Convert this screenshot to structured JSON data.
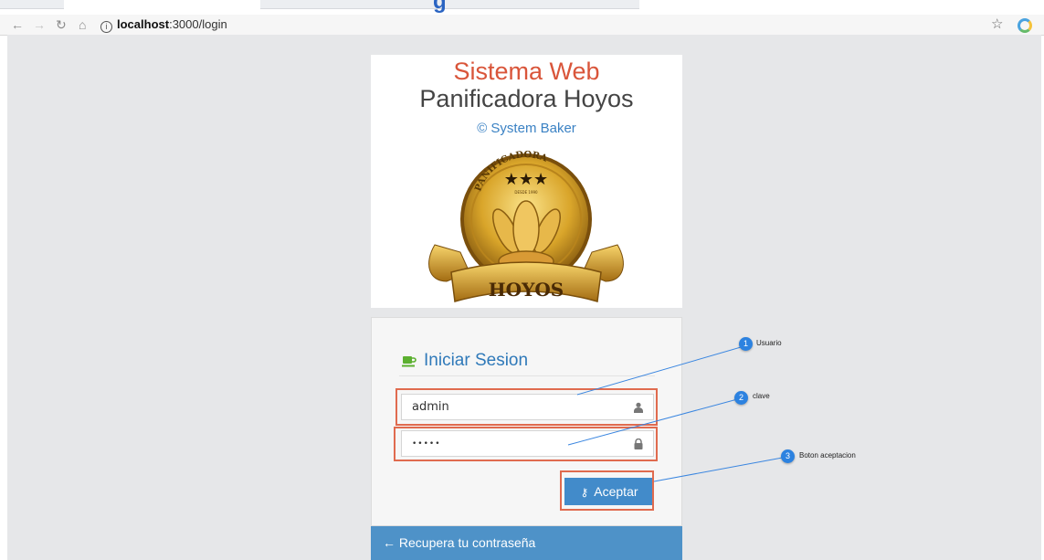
{
  "browser": {
    "url_host": "localhost",
    "url_path": ":3000/login",
    "title_fragment": "g"
  },
  "header": {
    "system_title": "Sistema Web",
    "company_name": "Panificadora Hoyos",
    "copyright": "© System Baker",
    "logo": {
      "top_text": "PANIFICADORA",
      "since_text": "DESDE 1990",
      "name": "HOYOS"
    }
  },
  "login": {
    "title": "Iniciar Sesion",
    "username": {
      "value": "admin"
    },
    "password": {
      "value": "•••••"
    },
    "submit_label": "Aceptar",
    "recover_label": "Recupera tu contraseña"
  },
  "annotations": [
    {
      "number": "1",
      "label": "Usuario"
    },
    {
      "number": "2",
      "label": "clave"
    },
    {
      "number": "3",
      "label": "Boton aceptacion"
    }
  ],
  "colors": {
    "brand_red": "#d9553a",
    "primary_blue": "#428bca",
    "callout_blue": "#2c82e0",
    "highlight": "#e06b4f"
  }
}
